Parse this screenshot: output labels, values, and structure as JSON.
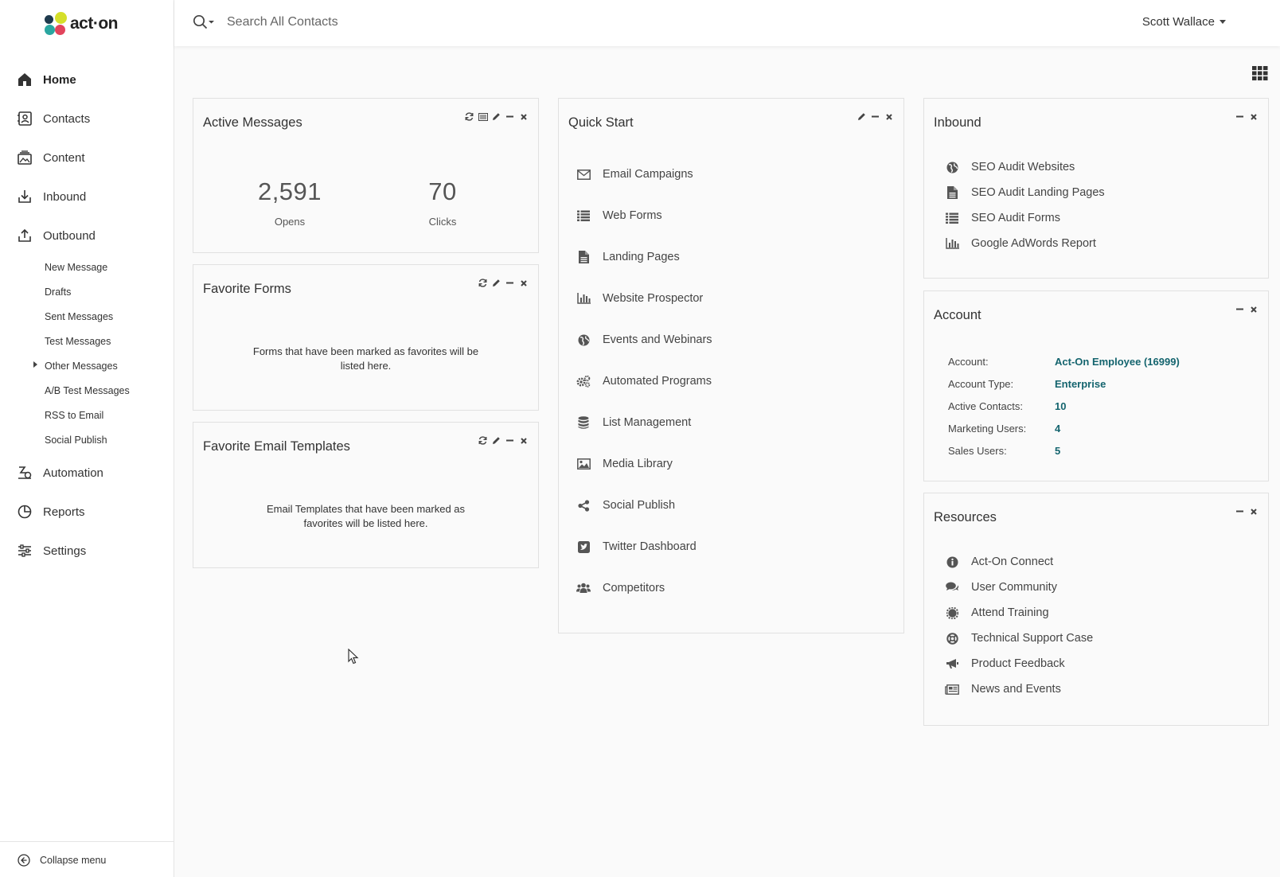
{
  "app": {
    "logo_text": "act·on",
    "brand_colors": {
      "yellow": "#d5df2a",
      "teal": "#2aa6a0",
      "pink": "#e2445c",
      "dark": "#1f3a4d",
      "link": "#14646e"
    }
  },
  "sidebar": {
    "items": [
      {
        "label": "Home",
        "icon": "home-icon"
      },
      {
        "label": "Contacts",
        "icon": "contacts-icon"
      },
      {
        "label": "Content",
        "icon": "content-icon"
      },
      {
        "label": "Inbound",
        "icon": "inbound-icon"
      },
      {
        "label": "Outbound",
        "icon": "outbound-icon"
      },
      {
        "label": "Automation",
        "icon": "automation-icon"
      },
      {
        "label": "Reports",
        "icon": "reports-icon"
      },
      {
        "label": "Settings",
        "icon": "settings-icon"
      }
    ],
    "outbound_sub": [
      "New Message",
      "Drafts",
      "Sent Messages",
      "Test Messages",
      "Other Messages",
      "A/B Test Messages",
      "RSS to Email",
      "Social Publish"
    ],
    "collapse_label": "Collapse menu"
  },
  "topbar": {
    "search_placeholder": "Search All Contacts",
    "user_name": "Scott Wallace"
  },
  "active_messages": {
    "title": "Active Messages",
    "opens_value": "2,591",
    "opens_label": "Opens",
    "clicks_value": "70",
    "clicks_label": "Clicks"
  },
  "favorite_forms": {
    "title": "Favorite Forms",
    "empty_text": "Forms that have been marked as favorites will be listed here."
  },
  "favorite_templates": {
    "title": "Favorite Email Templates",
    "empty_text": "Email Templates that have been marked as favorites will be listed here."
  },
  "quick_start": {
    "title": "Quick Start",
    "items": [
      {
        "label": "Email Campaigns",
        "icon": "envelope-icon"
      },
      {
        "label": "Web Forms",
        "icon": "list-icon"
      },
      {
        "label": "Landing Pages",
        "icon": "document-icon"
      },
      {
        "label": "Website Prospector",
        "icon": "bar-chart-icon"
      },
      {
        "label": "Events and Webinars",
        "icon": "globe-icon"
      },
      {
        "label": "Automated Programs",
        "icon": "cogs-icon"
      },
      {
        "label": "List Management",
        "icon": "database-icon"
      },
      {
        "label": "Media Library",
        "icon": "image-icon"
      },
      {
        "label": "Social Publish",
        "icon": "share-icon"
      },
      {
        "label": "Twitter Dashboard",
        "icon": "twitter-icon"
      },
      {
        "label": "Competitors",
        "icon": "users-icon"
      }
    ]
  },
  "inbound": {
    "title": "Inbound",
    "items": [
      {
        "label": "SEO Audit Websites",
        "icon": "globe-icon"
      },
      {
        "label": "SEO Audit Landing Pages",
        "icon": "document-icon"
      },
      {
        "label": "SEO Audit Forms",
        "icon": "list-icon"
      },
      {
        "label": "Google AdWords Report",
        "icon": "bar-chart-icon"
      }
    ]
  },
  "account": {
    "title": "Account",
    "rows": [
      {
        "key": "Account:",
        "value": "Act-On Employee (16999)"
      },
      {
        "key": "Account Type:",
        "value": "Enterprise"
      },
      {
        "key": "Active Contacts:",
        "value": "10"
      },
      {
        "key": "Marketing Users:",
        "value": "4"
      },
      {
        "key": "Sales Users:",
        "value": "5"
      }
    ]
  },
  "resources": {
    "title": "Resources",
    "items": [
      {
        "label": "Act-On Connect",
        "icon": "info-icon"
      },
      {
        "label": "User Community",
        "icon": "comments-icon"
      },
      {
        "label": "Attend Training",
        "icon": "badge-icon"
      },
      {
        "label": "Technical Support Case",
        "icon": "lifebuoy-icon"
      },
      {
        "label": "Product Feedback",
        "icon": "megaphone-icon"
      },
      {
        "label": "News and Events",
        "icon": "newspaper-icon"
      }
    ]
  }
}
